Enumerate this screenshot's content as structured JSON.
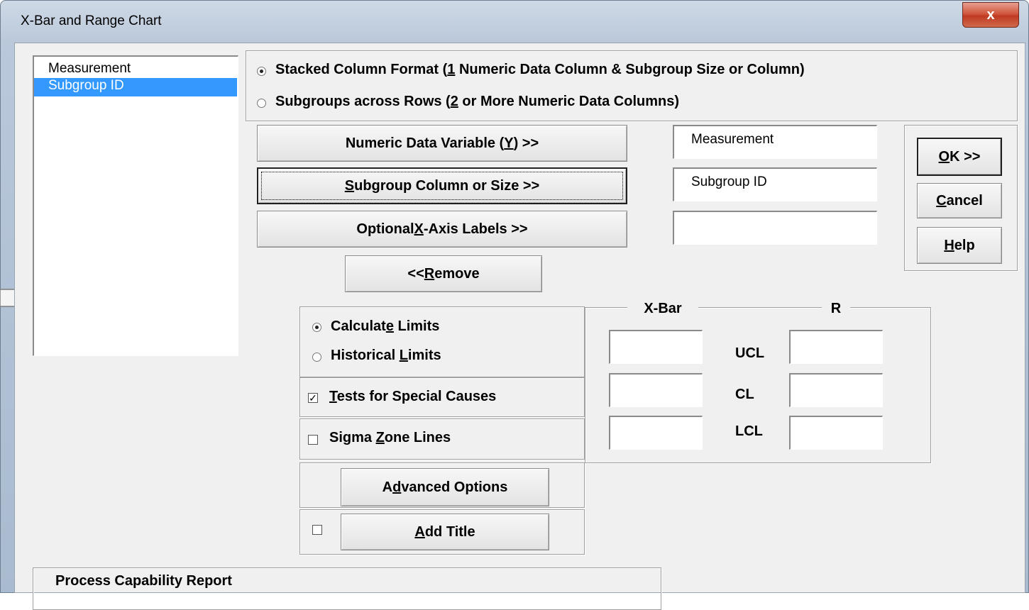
{
  "window": {
    "title": "X-Bar and Range Chart",
    "close_label": "x"
  },
  "variables_list": {
    "items": [
      "Measurement",
      "Subgroup ID"
    ],
    "selected_index": 1
  },
  "format": {
    "stacked": "Stacked Column Format (1 Numeric Data Column & Subgroup Size or Column)",
    "rows": "Subgroups across Rows (2 or More Numeric Data Columns)",
    "selected": "stacked"
  },
  "buttons": {
    "numeric": "Numeric Data Variable (Y) >>",
    "subgroup": "Subgroup Column or Size >>",
    "xaxis": "Optional X-Axis Labels >>",
    "remove": "<< Remove",
    "ok": "OK >>",
    "cancel": "Cancel",
    "help": "Help",
    "advanced": "Advanced Options",
    "add_title": "Add Title"
  },
  "fields": {
    "numeric": "Measurement",
    "subgroup": "Subgroup ID",
    "xaxis": ""
  },
  "limits_mode": {
    "calculate": "Calculate Limits",
    "historical": "Historical Limits",
    "selected": "calculate"
  },
  "options": {
    "tests": "Tests for Special Causes",
    "tests_checked": true,
    "sigma": "Sigma Zone Lines",
    "sigma_checked": false,
    "add_title_checked": false
  },
  "limits": {
    "col_xbar": "X-Bar",
    "col_r": "R",
    "rows": [
      "UCL",
      "CL",
      "LCL"
    ]
  },
  "capability": {
    "title": "Process Capability Report"
  },
  "colors": {
    "selection": "#3399ff",
    "close_button": "#c94a33"
  }
}
